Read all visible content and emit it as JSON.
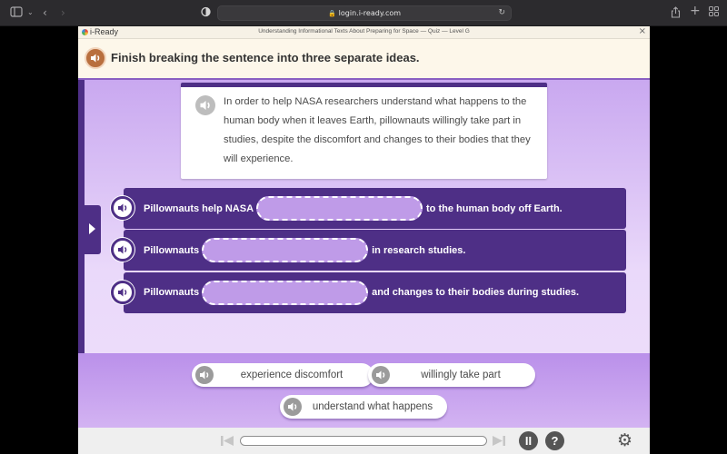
{
  "browser": {
    "url": "login.i-ready.com",
    "icons": [
      "sidebar-icon",
      "chevron-down-icon",
      "back-icon",
      "forward-icon",
      "privacy-shield-icon",
      "lock-icon",
      "reload-icon",
      "share-icon",
      "new-tab-icon",
      "tab-overview-icon"
    ]
  },
  "app": {
    "logo": "i-Ready",
    "lesson_title": "Understanding Informational Texts About Preparing for Space — Quiz — Level G",
    "close_label": "×",
    "prompt": "Finish breaking the sentence into three separate ideas.",
    "passage": "In order to help NASA researchers understand what happens to the human body when it leaves Earth, pillownauts willingly take part in studies, despite the discomfort and changes to their bodies that they will experience.",
    "rows": [
      {
        "before": "Pillownauts help NASA",
        "blank": "",
        "after": "to the human body off Earth."
      },
      {
        "before": "Pillownauts",
        "blank": "",
        "after": "in research studies."
      },
      {
        "before": "Pillownauts",
        "blank": "",
        "after": "and changes to their bodies during studies."
      }
    ],
    "answer_choices": [
      "experience discomfort",
      "willingly take part",
      "understand what happens"
    ],
    "footer": {
      "progress_fraction": 0,
      "pause_label": "II",
      "help_label": "?",
      "settings_icon": "⚙"
    },
    "colors": {
      "accent_purple": "#4e2f86",
      "prompt_audio": "#b96f3e",
      "blank_fill": "#bf9be8"
    }
  }
}
